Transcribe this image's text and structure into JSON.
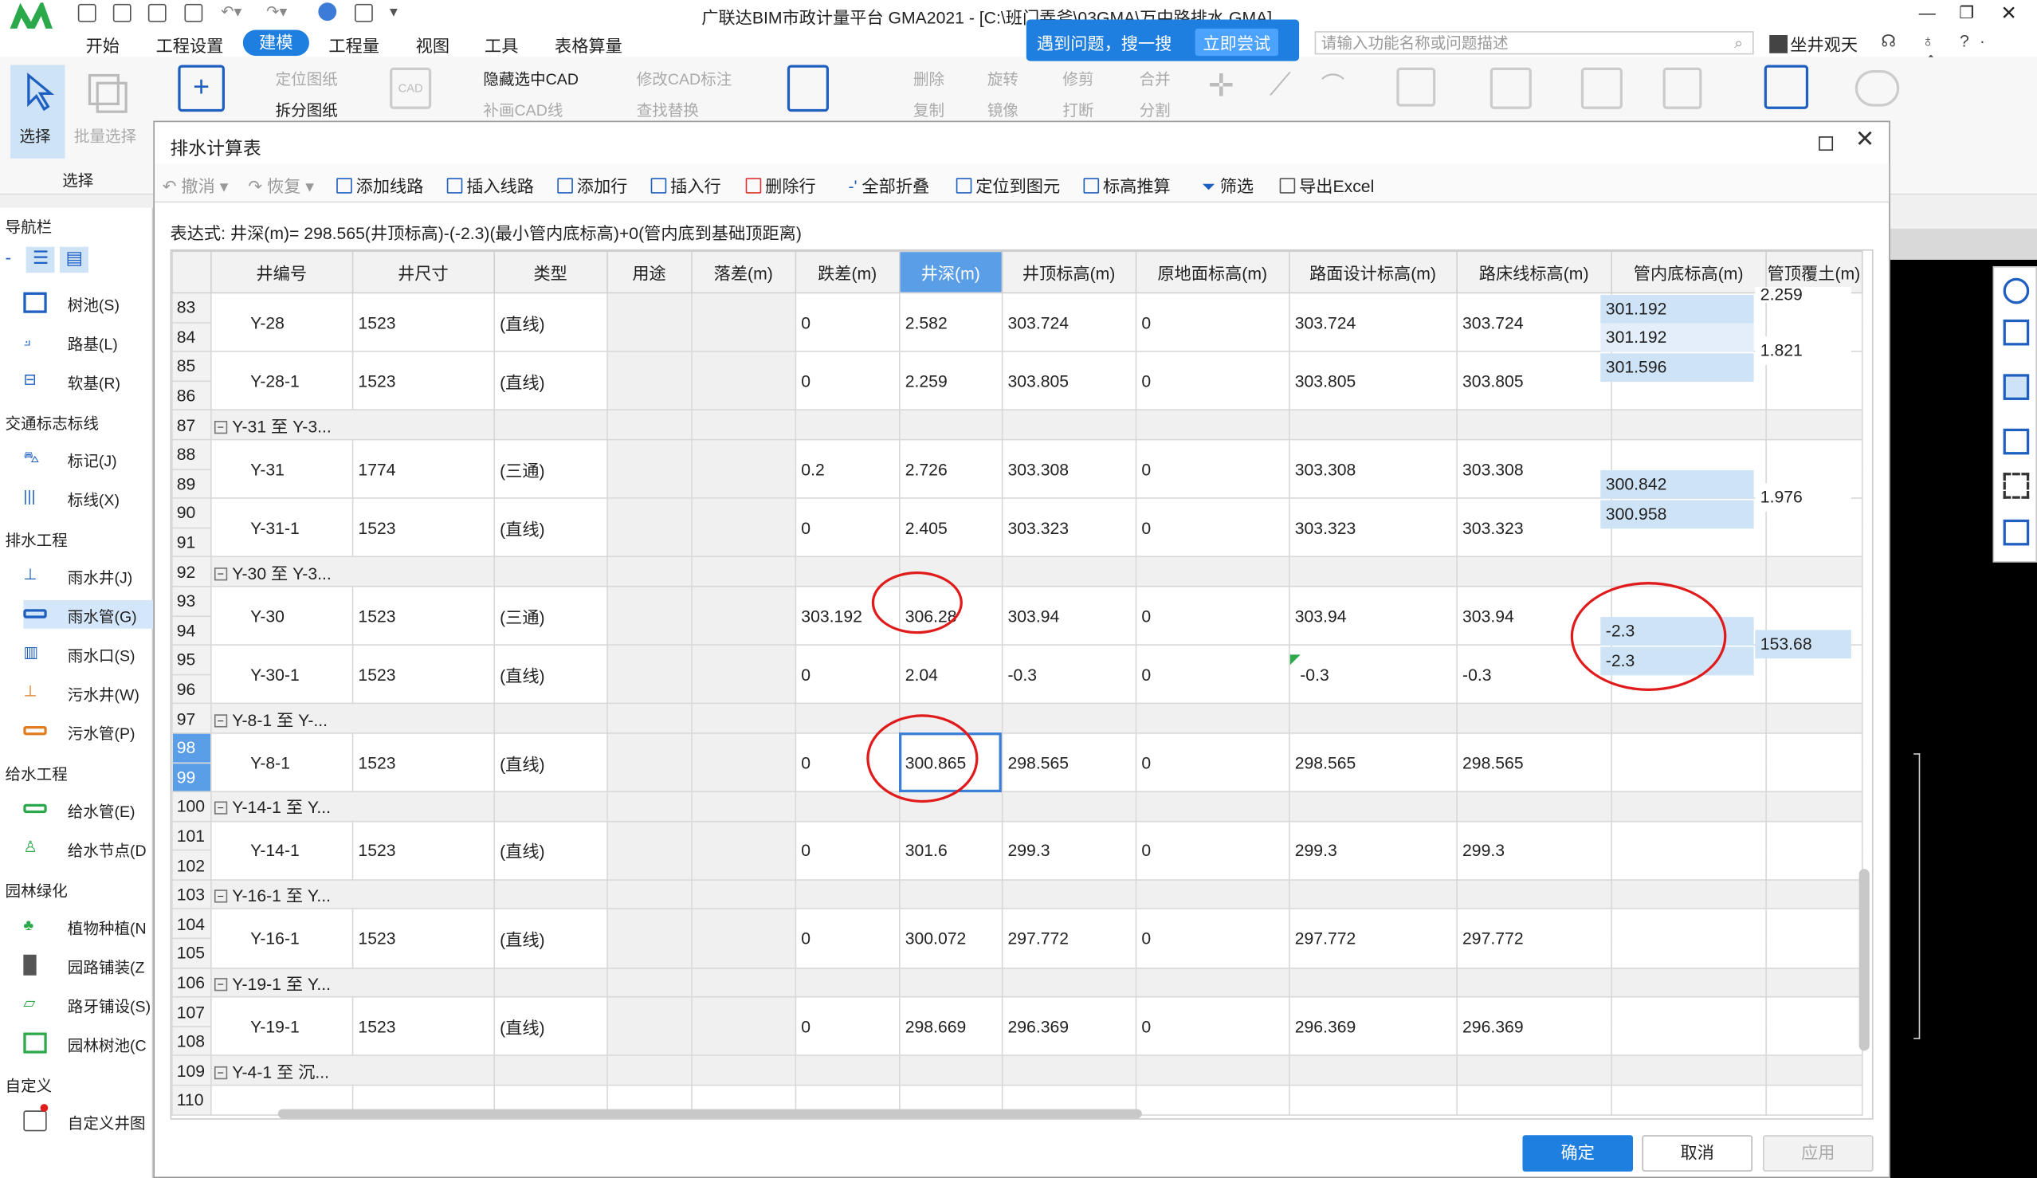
{
  "app": {
    "title": "广联达BIM市政计量平台 GMA2021 - [C:\\班门弄斧\\03GMA\\万中路排水.GMA]",
    "popup_text": "遇到问题，搜一搜",
    "popup_button": "立即尝试",
    "search_placeholder": "请输入功能名称或问题描述",
    "user": "坐井观天"
  },
  "menu": [
    "开始",
    "工程设置",
    "建模",
    "工程量",
    "视图",
    "工具",
    "表格算量"
  ],
  "menu_active": "建模",
  "ribbon": {
    "select": "选择",
    "batch_select": "批量选择",
    "select_group": "选择",
    "locate_drawing": "定位图纸",
    "split_drawing": "拆分图纸",
    "hide_cad": "隐藏选中CAD",
    "modify_cad_label": "修改CAD标注",
    "draw_cad_line": "补画CAD线",
    "find_replace": "查找替换",
    "delete": "删除",
    "rotate": "旋转",
    "trim": "修剪",
    "merge": "合并",
    "copy": "复制",
    "mirror": "镜像",
    "break": "打断",
    "split": "分割"
  },
  "nav": {
    "header": "导航栏",
    "groups": [
      {
        "label": "交通标志标线",
        "items": []
      },
      {
        "label": "排水工程",
        "items": []
      },
      {
        "label": "给水工程",
        "items": []
      },
      {
        "label": "园林绿化",
        "items": []
      },
      {
        "label": "自定义",
        "items": []
      }
    ],
    "items": {
      "tree_pool": "树池(S)",
      "roadbed": "路基(L)",
      "soft_base": "软基(R)",
      "marker": "标记(J)",
      "marking_line": "标线(X)",
      "rain_well": "雨水井(J)",
      "rain_pipe": "雨水管(G)",
      "rain_inlet": "雨水口(S)",
      "sewage_well": "污水井(W)",
      "sewage_pipe": "污水管(P)",
      "water_pipe": "给水管(E)",
      "water_node": "给水节点(D",
      "plant": "植物种植(N",
      "garden_paving": "园路铺装(Z",
      "curb_paving": "路牙铺设(S)",
      "garden_tree_pool": "园林树池(C",
      "custom_well": "自定义井图"
    }
  },
  "dialog": {
    "title": "排水计算表",
    "toolbar": {
      "undo": "撤消",
      "redo": "恢复",
      "add_route": "添加线路",
      "insert_route": "插入线路",
      "add_row": "添加行",
      "insert_row": "插入行",
      "delete_row": "删除行",
      "collapse_all": "全部折叠",
      "locate": "定位到图元",
      "elevation_calc": "标高推算",
      "filter": "筛选",
      "export_excel": "导出Excel"
    },
    "expression": "表达式:  井深(m)= 298.565(井顶标高)-(-2.3)(最小管内底标高)+0(管内底到基础顶距离)",
    "columns": [
      "井编号",
      "井尺寸",
      "类型",
      "用途",
      "落差(m)",
      "跌差(m)",
      "井深(m)",
      "井顶标高(m)",
      "原地面标高(m)",
      "路面设计标高(m)",
      "路床线标高(m)",
      "管内底标高(m)",
      "管顶覆土(m)"
    ],
    "active_column": "井深(m)",
    "rows": [
      {
        "kind": "well",
        "rn": [
          "83",
          "84"
        ],
        "id": "Y-28",
        "size": "1523",
        "type": "(直线)",
        "use": "",
        "drop": "",
        "jump": "0",
        "depth": "2.582",
        "top": "303.724",
        "ground": "0",
        "design": "303.724",
        "bed": "303.724"
      },
      {
        "kind": "well",
        "rn": [
          "85",
          "86"
        ],
        "id": "Y-28-1",
        "size": "1523",
        "type": "(直线)",
        "use": "",
        "drop": "",
        "jump": "0",
        "depth": "2.259",
        "top": "303.805",
        "ground": "0",
        "design": "303.805",
        "bed": "303.805"
      },
      {
        "kind": "group",
        "rn": "87",
        "label": "Y-31 至 Y-3..."
      },
      {
        "kind": "well",
        "rn": [
          "88",
          "89"
        ],
        "id": "Y-31",
        "size": "1774",
        "type": "(三通)",
        "use": "",
        "drop": "",
        "jump": "0.2",
        "depth": "2.726",
        "top": "303.308",
        "ground": "0",
        "design": "303.308",
        "bed": "303.308"
      },
      {
        "kind": "well",
        "rn": [
          "90",
          "91"
        ],
        "id": "Y-31-1",
        "size": "1523",
        "type": "(直线)",
        "use": "",
        "drop": "",
        "jump": "0",
        "depth": "2.405",
        "top": "303.323",
        "ground": "0",
        "design": "303.323",
        "bed": "303.323"
      },
      {
        "kind": "group",
        "rn": "92",
        "label": "Y-30 至 Y-3..."
      },
      {
        "kind": "well",
        "rn": [
          "93",
          "94"
        ],
        "id": "Y-30",
        "size": "1523",
        "type": "(三通)",
        "use": "",
        "drop": "",
        "jump": "303.192",
        "depth": "306.28",
        "top": "303.94",
        "ground": "0",
        "design": "303.94",
        "bed": "303.94"
      },
      {
        "kind": "well",
        "rn": [
          "95",
          "96"
        ],
        "id": "Y-30-1",
        "size": "1523",
        "type": "(直线)",
        "use": "",
        "drop": "",
        "jump": "0",
        "depth": "2.04",
        "top": "-0.3",
        "ground": "0",
        "design": "-0.3",
        "bed": "-0.3"
      },
      {
        "kind": "group",
        "rn": "97",
        "label": "Y-8-1 至 Y-..."
      },
      {
        "kind": "well",
        "rn": [
          "98",
          "99"
        ],
        "id": "Y-8-1",
        "size": "1523",
        "type": "(直线)",
        "use": "",
        "drop": "",
        "jump": "0",
        "depth": "300.865",
        "top": "298.565",
        "ground": "0",
        "design": "298.565",
        "bed": "298.565"
      },
      {
        "kind": "group",
        "rn": "100",
        "label": "Y-14-1 至 Y..."
      },
      {
        "kind": "well",
        "rn": [
          "101",
          "102"
        ],
        "id": "Y-14-1",
        "size": "1523",
        "type": "(直线)",
        "use": "",
        "drop": "",
        "jump": "0",
        "depth": "301.6",
        "top": "299.3",
        "ground": "0",
        "design": "299.3",
        "bed": "299.3"
      },
      {
        "kind": "group",
        "rn": "103",
        "label": "Y-16-1 至 Y..."
      },
      {
        "kind": "well",
        "rn": [
          "104",
          "105"
        ],
        "id": "Y-16-1",
        "size": "1523",
        "type": "(直线)",
        "use": "",
        "drop": "",
        "jump": "0",
        "depth": "300.072",
        "top": "297.772",
        "ground": "0",
        "design": "297.772",
        "bed": "297.772"
      },
      {
        "kind": "group",
        "rn": "106",
        "label": "Y-19-1 至 Y..."
      },
      {
        "kind": "well",
        "rn": [
          "107",
          "108"
        ],
        "id": "Y-19-1",
        "size": "1523",
        "type": "(直线)",
        "use": "",
        "drop": "",
        "jump": "0",
        "depth": "298.669",
        "top": "296.369",
        "ground": "0",
        "design": "296.369",
        "bed": "296.369"
      },
      {
        "kind": "group",
        "rn": "109",
        "label": "Y-4-1 至 沉..."
      },
      {
        "kind": "tail",
        "rn": "110"
      }
    ],
    "pipe": {
      "p1": [
        "301.192",
        "301.192",
        "301.596"
      ],
      "cover1_top": "2.259",
      "cover1": "1.821",
      "p2": [
        "300.842",
        "300.958"
      ],
      "cover2": "1.976",
      "p3": [
        "-2.3",
        "-2.3"
      ],
      "cover3": "153.68"
    },
    "buttons": {
      "ok": "确定",
      "cancel": "取消",
      "apply": "应用"
    }
  }
}
